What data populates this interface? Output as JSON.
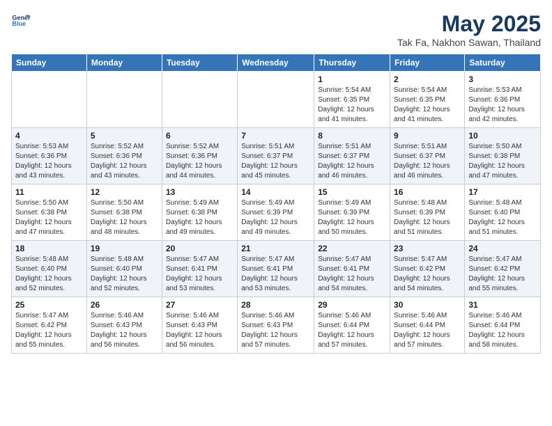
{
  "header": {
    "logo_line1": "General",
    "logo_line2": "Blue",
    "month_title": "May 2025",
    "subtitle": "Tak Fa, Nakhon Sawan, Thailand"
  },
  "days_of_week": [
    "Sunday",
    "Monday",
    "Tuesday",
    "Wednesday",
    "Thursday",
    "Friday",
    "Saturday"
  ],
  "weeks": [
    [
      {
        "day": "",
        "info": ""
      },
      {
        "day": "",
        "info": ""
      },
      {
        "day": "",
        "info": ""
      },
      {
        "day": "",
        "info": ""
      },
      {
        "day": "1",
        "info": "Sunrise: 5:54 AM\nSunset: 6:35 PM\nDaylight: 12 hours\nand 41 minutes."
      },
      {
        "day": "2",
        "info": "Sunrise: 5:54 AM\nSunset: 6:35 PM\nDaylight: 12 hours\nand 41 minutes."
      },
      {
        "day": "3",
        "info": "Sunrise: 5:53 AM\nSunset: 6:36 PM\nDaylight: 12 hours\nand 42 minutes."
      }
    ],
    [
      {
        "day": "4",
        "info": "Sunrise: 5:53 AM\nSunset: 6:36 PM\nDaylight: 12 hours\nand 43 minutes."
      },
      {
        "day": "5",
        "info": "Sunrise: 5:52 AM\nSunset: 6:36 PM\nDaylight: 12 hours\nand 43 minutes."
      },
      {
        "day": "6",
        "info": "Sunrise: 5:52 AM\nSunset: 6:36 PM\nDaylight: 12 hours\nand 44 minutes."
      },
      {
        "day": "7",
        "info": "Sunrise: 5:51 AM\nSunset: 6:37 PM\nDaylight: 12 hours\nand 45 minutes."
      },
      {
        "day": "8",
        "info": "Sunrise: 5:51 AM\nSunset: 6:37 PM\nDaylight: 12 hours\nand 46 minutes."
      },
      {
        "day": "9",
        "info": "Sunrise: 5:51 AM\nSunset: 6:37 PM\nDaylight: 12 hours\nand 46 minutes."
      },
      {
        "day": "10",
        "info": "Sunrise: 5:50 AM\nSunset: 6:38 PM\nDaylight: 12 hours\nand 47 minutes."
      }
    ],
    [
      {
        "day": "11",
        "info": "Sunrise: 5:50 AM\nSunset: 6:38 PM\nDaylight: 12 hours\nand 47 minutes."
      },
      {
        "day": "12",
        "info": "Sunrise: 5:50 AM\nSunset: 6:38 PM\nDaylight: 12 hours\nand 48 minutes."
      },
      {
        "day": "13",
        "info": "Sunrise: 5:49 AM\nSunset: 6:38 PM\nDaylight: 12 hours\nand 49 minutes."
      },
      {
        "day": "14",
        "info": "Sunrise: 5:49 AM\nSunset: 6:39 PM\nDaylight: 12 hours\nand 49 minutes."
      },
      {
        "day": "15",
        "info": "Sunrise: 5:49 AM\nSunset: 6:39 PM\nDaylight: 12 hours\nand 50 minutes."
      },
      {
        "day": "16",
        "info": "Sunrise: 5:48 AM\nSunset: 6:39 PM\nDaylight: 12 hours\nand 51 minutes."
      },
      {
        "day": "17",
        "info": "Sunrise: 5:48 AM\nSunset: 6:40 PM\nDaylight: 12 hours\nand 51 minutes."
      }
    ],
    [
      {
        "day": "18",
        "info": "Sunrise: 5:48 AM\nSunset: 6:40 PM\nDaylight: 12 hours\nand 52 minutes."
      },
      {
        "day": "19",
        "info": "Sunrise: 5:48 AM\nSunset: 6:40 PM\nDaylight: 12 hours\nand 52 minutes."
      },
      {
        "day": "20",
        "info": "Sunrise: 5:47 AM\nSunset: 6:41 PM\nDaylight: 12 hours\nand 53 minutes."
      },
      {
        "day": "21",
        "info": "Sunrise: 5:47 AM\nSunset: 6:41 PM\nDaylight: 12 hours\nand 53 minutes."
      },
      {
        "day": "22",
        "info": "Sunrise: 5:47 AM\nSunset: 6:41 PM\nDaylight: 12 hours\nand 54 minutes."
      },
      {
        "day": "23",
        "info": "Sunrise: 5:47 AM\nSunset: 6:42 PM\nDaylight: 12 hours\nand 54 minutes."
      },
      {
        "day": "24",
        "info": "Sunrise: 5:47 AM\nSunset: 6:42 PM\nDaylight: 12 hours\nand 55 minutes."
      }
    ],
    [
      {
        "day": "25",
        "info": "Sunrise: 5:47 AM\nSunset: 6:42 PM\nDaylight: 12 hours\nand 55 minutes."
      },
      {
        "day": "26",
        "info": "Sunrise: 5:46 AM\nSunset: 6:43 PM\nDaylight: 12 hours\nand 56 minutes."
      },
      {
        "day": "27",
        "info": "Sunrise: 5:46 AM\nSunset: 6:43 PM\nDaylight: 12 hours\nand 56 minutes."
      },
      {
        "day": "28",
        "info": "Sunrise: 5:46 AM\nSunset: 6:43 PM\nDaylight: 12 hours\nand 57 minutes."
      },
      {
        "day": "29",
        "info": "Sunrise: 5:46 AM\nSunset: 6:44 PM\nDaylight: 12 hours\nand 57 minutes."
      },
      {
        "day": "30",
        "info": "Sunrise: 5:46 AM\nSunset: 6:44 PM\nDaylight: 12 hours\nand 57 minutes."
      },
      {
        "day": "31",
        "info": "Sunrise: 5:46 AM\nSunset: 6:44 PM\nDaylight: 12 hours\nand 58 minutes."
      }
    ]
  ]
}
